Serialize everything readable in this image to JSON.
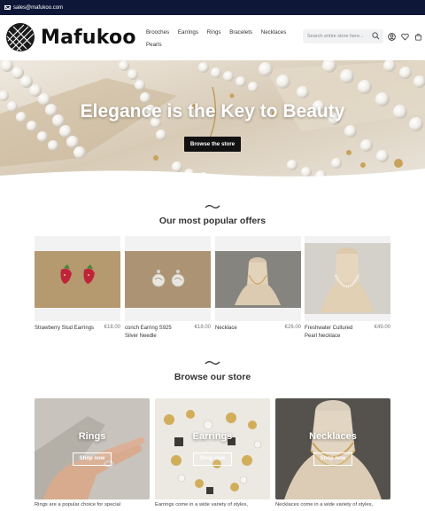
{
  "topbar": {
    "email": "sales@mafukoo.com"
  },
  "header": {
    "brand": "Mafukoo",
    "nav": [
      "Brooches",
      "Earrings",
      "Rings",
      "Bracelets",
      "Necklaces",
      "Pearls"
    ],
    "search_placeholder": "Search entire store here..."
  },
  "hero": {
    "title": "Elegance is the Key to Beauty",
    "button": "Browse the store"
  },
  "popular": {
    "title": "Our most popular offers",
    "products": [
      {
        "name": "Strawberry Stud Earrings",
        "price": "€18.00"
      },
      {
        "name": "conch Earring S925 Silver Needle",
        "price": "€18.00"
      },
      {
        "name": "Necklace",
        "price": "€26.00"
      },
      {
        "name": "Freshwater Cultured Pearl Necklace",
        "price": "€49.00"
      }
    ]
  },
  "browse": {
    "title": "Browse our store",
    "categories": [
      {
        "title": "Rings",
        "button": "Shop now",
        "desc": "Rings are a popular choice for special"
      },
      {
        "title": "Earrings",
        "button": "Shop now",
        "desc": "Earrings come in a wide variety of styles,"
      },
      {
        "title": "Necklaces",
        "button": "Shop now",
        "desc": "Necklaces come in a wide variety of styles,"
      }
    ]
  },
  "colors": {
    "topbar": "#0e1738",
    "button": "#111111",
    "accent": "#222222"
  },
  "icons": [
    "mail-icon",
    "search-icon",
    "account-icon",
    "wishlist-icon",
    "cart-icon",
    "wave-divider-icon"
  ]
}
